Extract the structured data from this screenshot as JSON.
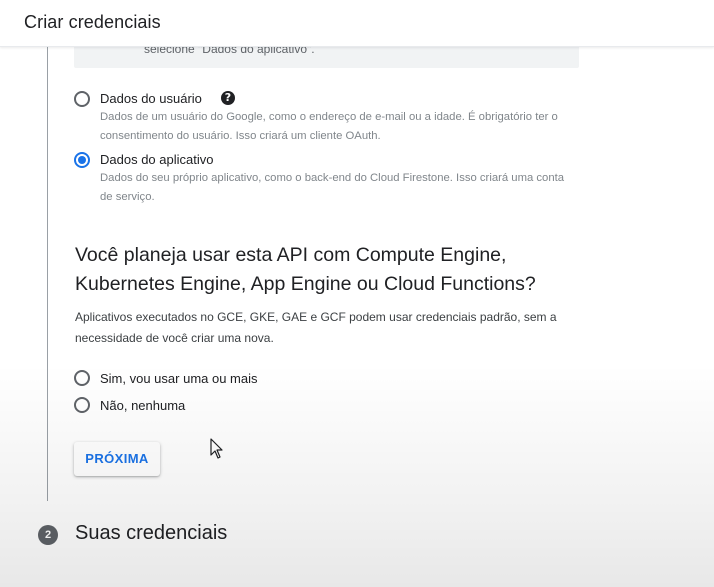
{
  "header": {
    "title": "Criar credenciais"
  },
  "previous_section": {
    "truncated_text": "selecione \"Dados do aplicativo\"."
  },
  "data_type_options": [
    {
      "label": "Dados do usuário",
      "description": "Dados de um usuário do Google, como o endereço de e-mail ou a idade. É obrigatório ter o consentimento do usuário. Isso criará um cliente OAuth.",
      "selected": false,
      "help_icon": "help-icon"
    },
    {
      "label": "Dados do aplicativo",
      "description": "Dados do seu próprio aplicativo, como o back-end do Cloud Firestone. Isso criará uma conta de serviço.",
      "selected": true
    }
  ],
  "question": {
    "title": "Você planeja usar esta API com Compute Engine, Kubernetes Engine, App Engine ou Cloud Functions?",
    "description": "Aplicativos executados no GCE, GKE, GAE e GCF podem usar credenciais padrão, sem a necessidade de você criar uma nova."
  },
  "usage_options": [
    {
      "label": "Sim, vou usar uma ou mais",
      "selected": false
    },
    {
      "label": "Não, nenhuma",
      "selected": false
    }
  ],
  "next_button": {
    "label": "PRÓXIMA"
  },
  "step2": {
    "number": "2",
    "title": "Suas credenciais"
  },
  "colors": {
    "accent": "#1a73e8",
    "text": "#202124",
    "muted": "#80868b"
  }
}
